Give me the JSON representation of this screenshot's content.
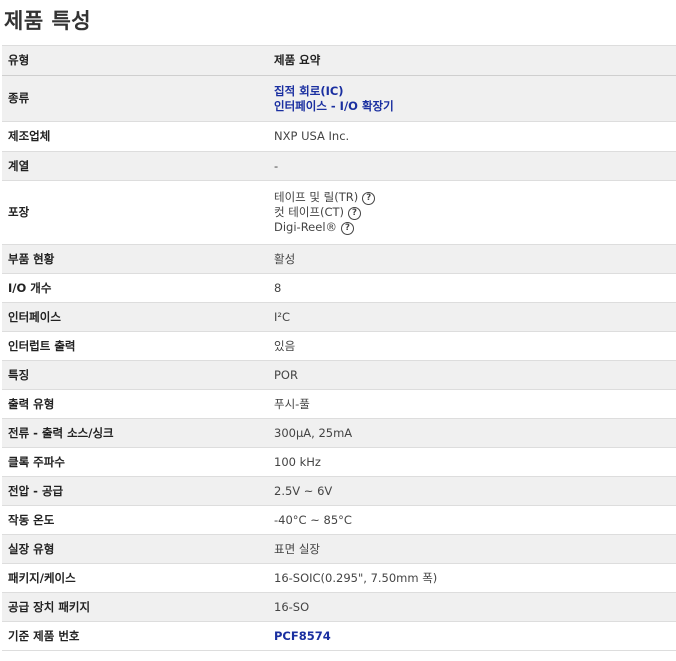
{
  "title": "제품 특성",
  "header": {
    "type": "유형",
    "summary": "제품 요약"
  },
  "rows": {
    "category": {
      "label": "종류",
      "values": [
        "집적 회로(IC)",
        "인터페이스 - I/O 확장기"
      ]
    },
    "manufacturer": {
      "label": "제조업체",
      "value": "NXP USA Inc."
    },
    "series": {
      "label": "계열",
      "value": "-"
    },
    "packaging": {
      "label": "포장",
      "values": [
        "테이프 및 릴(TR)",
        "컷 테이프(CT)",
        "Digi-Reel®"
      ],
      "help_icon": "question-circle-icon"
    },
    "part_status": {
      "label": "부품 현황",
      "value": "활성"
    },
    "io_count": {
      "label": "I/O 개수",
      "value": "8"
    },
    "interface": {
      "label": "인터페이스",
      "value": "I²C"
    },
    "interrupt_output": {
      "label": "인터럽트 출력",
      "value": "있음"
    },
    "features": {
      "label": "특징",
      "value": "POR"
    },
    "output_type": {
      "label": "출력 유형",
      "value": "푸시-풀"
    },
    "current": {
      "label": "전류 - 출력 소스/싱크",
      "value": "300µA, 25mA"
    },
    "clock": {
      "label": "클록 주파수",
      "value": "100 kHz"
    },
    "voltage": {
      "label": "전압 - 공급",
      "value": "2.5V ~ 6V"
    },
    "temp": {
      "label": "작동 온도",
      "value": "-40°C ~ 85°C"
    },
    "mounting": {
      "label": "실장 유형",
      "value": "표면 실장"
    },
    "package_case": {
      "label": "패키지/케이스",
      "value": "16-SOIC(0.295\", 7.50mm 폭)"
    },
    "supplier_package": {
      "label": "공급 장치 패키지",
      "value": "16-SO"
    },
    "base_part": {
      "label": "기준 제품 번호",
      "value": "PCF8574"
    }
  },
  "colors": {
    "link": "#1a2fa0",
    "stripe": "#f0f0f0",
    "border": "#dddddd"
  }
}
